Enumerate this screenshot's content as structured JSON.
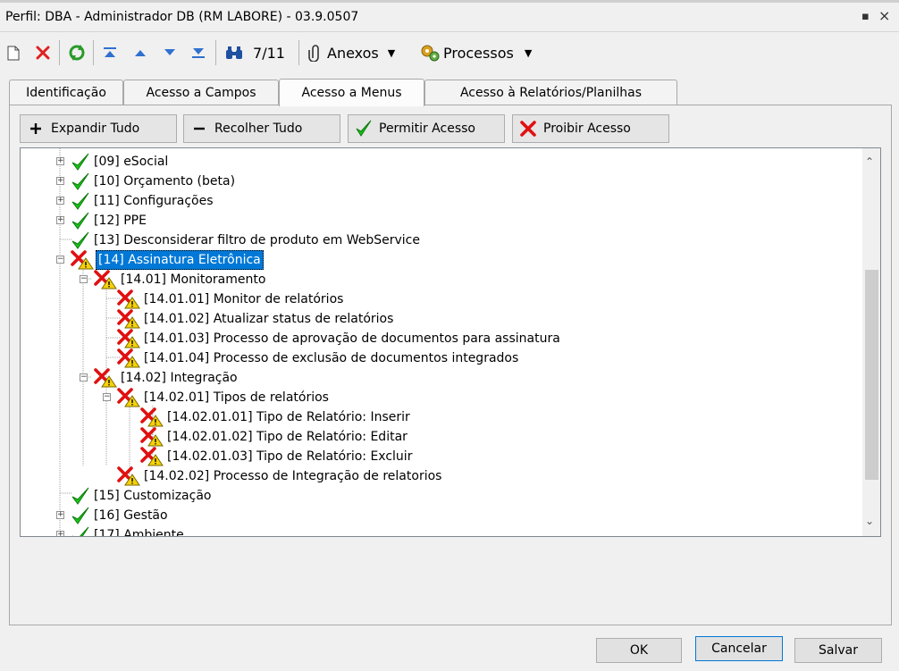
{
  "window": {
    "title": "Perfil: DBA - Administrador DB (RM LABORE) - 03.9.0507",
    "restore_glyph": "▪",
    "close_glyph": "×"
  },
  "toolbar": {
    "record_position": "7/11",
    "attachments_label": "Anexos",
    "processes_label": "Processos"
  },
  "tabs": [
    {
      "label": "Identificação",
      "active": false
    },
    {
      "label": "Acesso a Campos",
      "active": false
    },
    {
      "label": "Acesso a Menus",
      "active": true
    },
    {
      "label": "Acesso à Relatórios/Planilhas",
      "active": false
    }
  ],
  "actions": {
    "expand_all": "Expandir Tudo",
    "collapse_all": "Recolher Tudo",
    "allow_access": "Permitir Acesso",
    "deny_access": "Proibir Acesso"
  },
  "tree": [
    {
      "label": "[09] eSocial",
      "status": "allowed",
      "expandable": true
    },
    {
      "label": "[10] Orçamento (beta)",
      "status": "allowed",
      "expandable": true
    },
    {
      "label": "[11] Configurações",
      "status": "allowed",
      "expandable": true
    },
    {
      "label": "[12] PPE",
      "status": "allowed",
      "expandable": true
    },
    {
      "label": "[13] Desconsiderar filtro de produto em WebService",
      "status": "allowed",
      "expandable": false
    },
    {
      "label": "[14] Assinatura Eletrônica",
      "status": "denied",
      "expandable": true,
      "selected": true
    },
    {
      "label": "[14.01] Monitoramento",
      "status": "denied",
      "expandable": true
    },
    {
      "label": "[14.01.01] Monitor de relatórios",
      "status": "denied",
      "expandable": false
    },
    {
      "label": "[14.01.02] Atualizar status de relatórios",
      "status": "denied",
      "expandable": false
    },
    {
      "label": "[14.01.03] Processo de aprovação de documentos para assinatura",
      "status": "denied",
      "expandable": false
    },
    {
      "label": "[14.01.04] Processo de exclusão de documentos integrados",
      "status": "denied",
      "expandable": false
    },
    {
      "label": "[14.02] Integração",
      "status": "denied",
      "expandable": true
    },
    {
      "label": "[14.02.01] Tipos de relatórios",
      "status": "denied",
      "expandable": true
    },
    {
      "label": "[14.02.01.01] Tipo de Relatório: Inserir",
      "status": "denied",
      "expandable": false
    },
    {
      "label": "[14.02.01.02] Tipo de Relatório: Editar",
      "status": "denied",
      "expandable": false
    },
    {
      "label": "[14.02.01.03] Tipo de Relatório: Excluir",
      "status": "denied",
      "expandable": false
    },
    {
      "label": "[14.02.02] Processo de Integração de relatorios",
      "status": "denied",
      "expandable": false
    },
    {
      "label": "[15] Customização",
      "status": "allowed",
      "expandable": false
    },
    {
      "label": "[16] Gestão",
      "status": "allowed",
      "expandable": true
    },
    {
      "label": "[17] Ambiente",
      "status": "allowed",
      "expandable": true
    }
  ],
  "footer": {
    "ok": "OK",
    "cancel": "Cancelar",
    "save": "Salvar"
  }
}
